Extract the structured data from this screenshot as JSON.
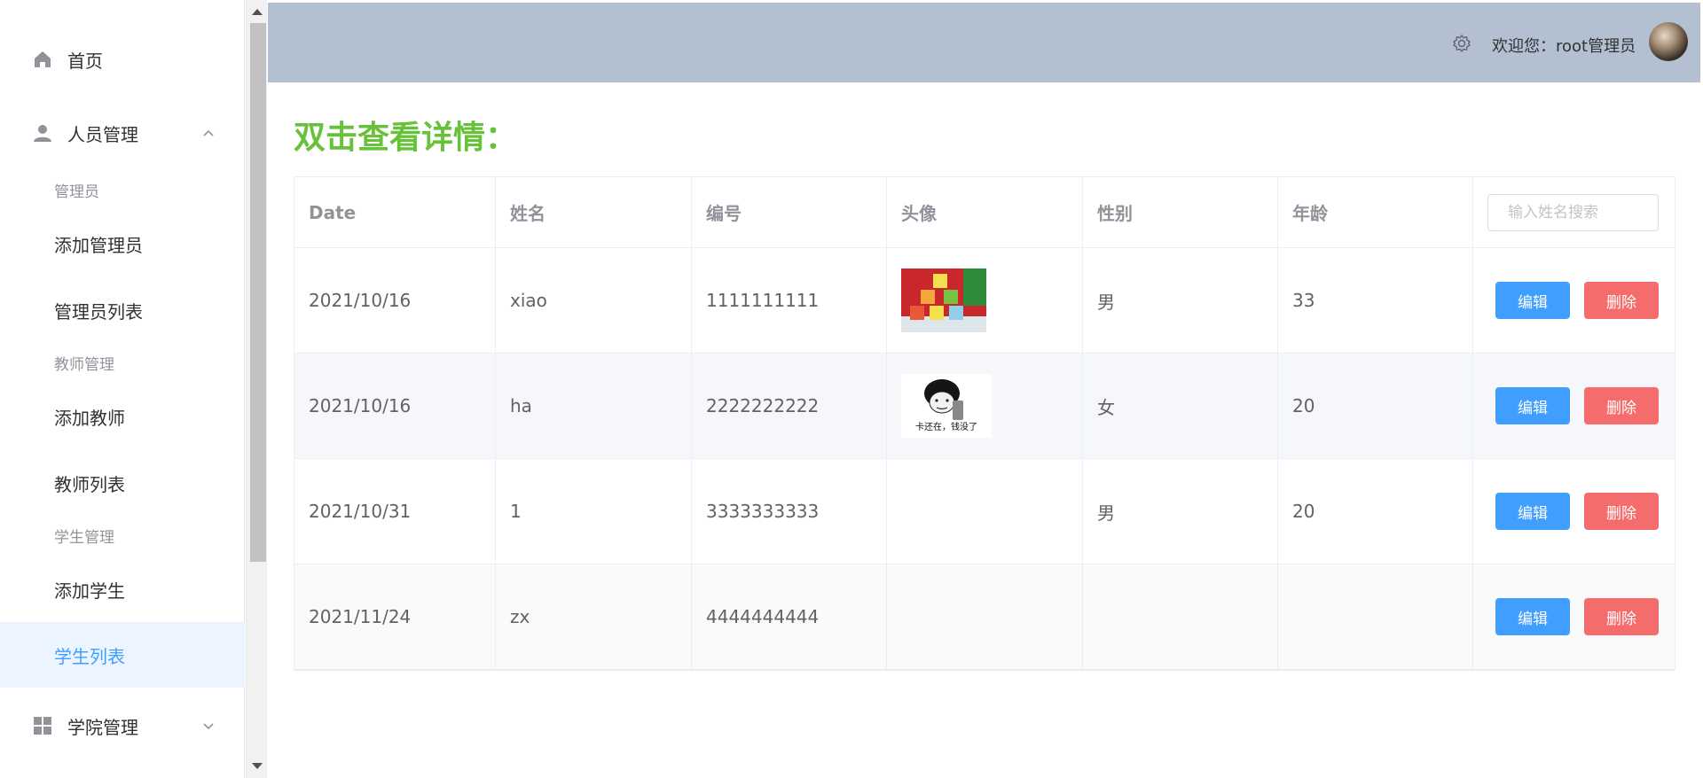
{
  "sidebar": {
    "home": "首页",
    "people": "人员管理",
    "group_admin": "管理员",
    "add_admin": "添加管理员",
    "admin_list": "管理员列表",
    "group_teacher": "教师管理",
    "add_teacher": "添加教师",
    "teacher_list": "教师列表",
    "group_student": "学生管理",
    "add_student": "添加学生",
    "student_list": "学生列表",
    "college": "学院管理"
  },
  "header": {
    "welcome": "欢迎您：root管理员"
  },
  "page_title": "双击查看详情：",
  "table": {
    "columns": [
      "Date",
      "姓名",
      "编号",
      "头像",
      "性别",
      "年龄"
    ],
    "search_placeholder": "输入姓名搜索",
    "edit_label": "编辑",
    "delete_label": "删除",
    "rows": [
      {
        "date": "2021/10/16",
        "name": "xiao",
        "id": "1111111111",
        "avatar": "abc-blocks-image",
        "gender": "男",
        "age": "33"
      },
      {
        "date": "2021/10/16",
        "name": "ha",
        "id": "2222222222",
        "avatar": "meme-image",
        "avatar_caption": "卡还在，钱没了",
        "gender": "女",
        "age": "20"
      },
      {
        "date": "2021/10/31",
        "name": "1",
        "id": "3333333333",
        "avatar": "",
        "gender": "男",
        "age": "20"
      },
      {
        "date": "2021/11/24",
        "name": "zx",
        "id": "4444444444",
        "avatar": "",
        "gender": "",
        "age": ""
      }
    ]
  },
  "colors": {
    "accent": "#409eff",
    "danger": "#f56c6c",
    "title_green": "#67c23a",
    "header_bg": "#b3c0d1",
    "active_bg": "#ecf5ff"
  }
}
